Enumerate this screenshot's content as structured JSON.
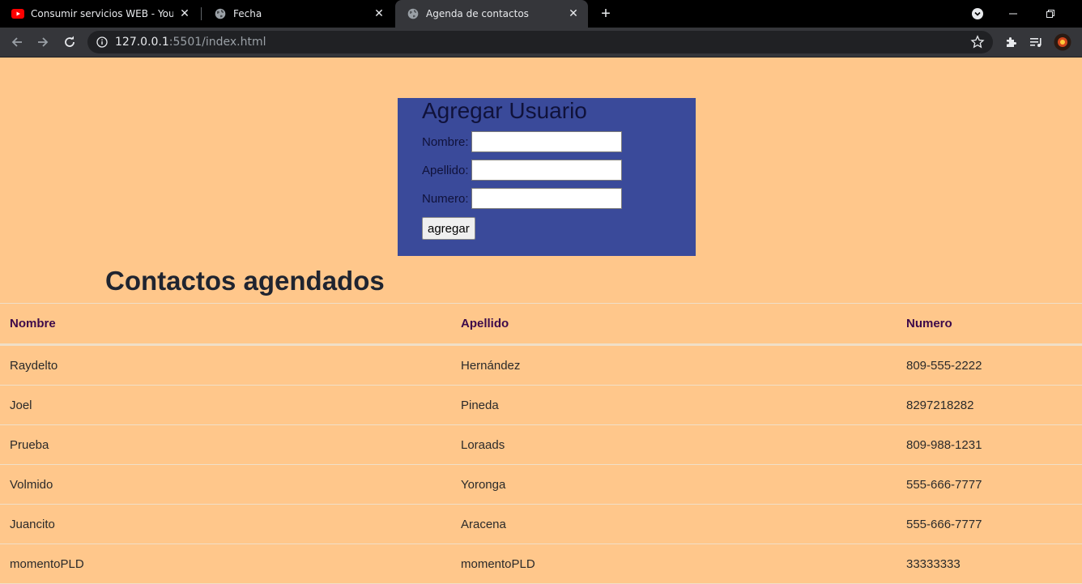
{
  "browser": {
    "tabs": [
      {
        "title": "Consumir servicios WEB - YouTube",
        "favicon": "youtube-icon",
        "active": false
      },
      {
        "title": "Fecha",
        "favicon": "globe-icon",
        "active": false
      },
      {
        "title": "Agenda de contactos",
        "favicon": "globe-icon",
        "active": true
      }
    ],
    "url_host": "127.0.0.1",
    "url_rest": ":5501/index.html"
  },
  "form": {
    "title": "Agregar Usuario",
    "fields": [
      {
        "label": "Nombre:",
        "value": ""
      },
      {
        "label": "Apellido:",
        "value": ""
      },
      {
        "label": "Numero:",
        "value": ""
      }
    ],
    "button_label": "agregar",
    "background_color": "#3a4a9a"
  },
  "contacts": {
    "title": "Contactos agendados",
    "columns": [
      "Nombre",
      "Apellido",
      "Numero"
    ],
    "rows": [
      [
        "Raydelto",
        "Hernández",
        "809-555-2222"
      ],
      [
        "Joel",
        "Pineda",
        "8297218282"
      ],
      [
        "Prueba",
        "Loraads",
        "809-988-1231"
      ],
      [
        "Volmido",
        "Yoronga",
        "555-666-7777"
      ],
      [
        "Juancito",
        "Aracena",
        "555-666-7777"
      ],
      [
        "momentoPLD",
        "momentoPLD",
        "33333333"
      ]
    ]
  },
  "colors": {
    "page_background": "#ffc78b",
    "header_text": "#3d0a4a"
  }
}
